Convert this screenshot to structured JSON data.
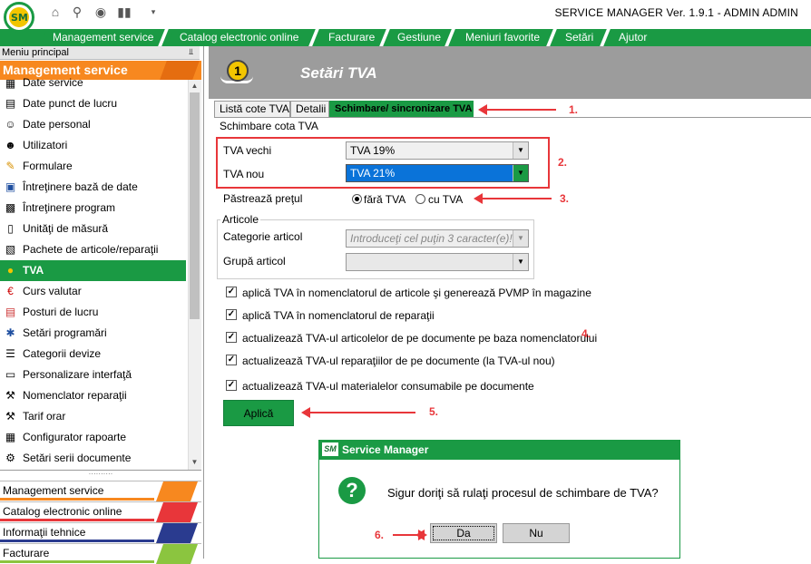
{
  "app": {
    "title": "SERVICE MANAGER Ver. 1.9.1 - ADMIN ADMIN",
    "logo_text": "SM"
  },
  "quick_toolbar": [
    "home-icon",
    "search-icon",
    "binoculars-icon",
    "barcode-icon",
    "dropdown-icon"
  ],
  "menu": [
    {
      "label": "Management service"
    },
    {
      "label": "Catalog electronic online"
    },
    {
      "label": "Facturare"
    },
    {
      "label": "Gestiune"
    },
    {
      "label": "Meniuri favorite"
    },
    {
      "label": "Setări"
    },
    {
      "label": "Ajutor"
    }
  ],
  "left_panel": {
    "header": "Meniu principal",
    "pin": "⫫",
    "category": "Management service",
    "items": [
      {
        "label": "Date service",
        "icon": "building-icon"
      },
      {
        "label": "Date punct de lucru",
        "icon": "document-icon"
      },
      {
        "label": "Date personal",
        "icon": "person-icon"
      },
      {
        "label": "Utilizatori",
        "icon": "users-icon"
      },
      {
        "label": "Formulare",
        "icon": "pencil-icon"
      },
      {
        "label": "Întreţinere bază de date",
        "icon": "floppy-icon"
      },
      {
        "label": "Întreţinere program",
        "icon": "program-icon"
      },
      {
        "label": "Unităţi de măsură",
        "icon": "ruler-icon"
      },
      {
        "label": "Pachete de articole/reparaţii",
        "icon": "package-icon"
      },
      {
        "label": "TVA",
        "icon": "tva-icon",
        "selected": true
      },
      {
        "label": "Curs valutar",
        "icon": "euro-icon"
      },
      {
        "label": "Posturi de lucru",
        "icon": "workstation-icon"
      },
      {
        "label": "Setări programări",
        "icon": "wrench-icon"
      },
      {
        "label": "Categorii devize",
        "icon": "list-icon"
      },
      {
        "label": "Personalizare interfaţă",
        "icon": "monitor-icon"
      },
      {
        "label": "Nomenclator reparaţii",
        "icon": "tools-icon"
      },
      {
        "label": "Tarif orar",
        "icon": "hammer-icon"
      },
      {
        "label": "Configurator rapoarte",
        "icon": "report-icon"
      },
      {
        "label": "Setări serii documente",
        "icon": "gear-icon"
      }
    ],
    "bottom_categories": [
      {
        "label": "Management service",
        "color": "#f7881f"
      },
      {
        "label": "Catalog electronic online",
        "color": "#e8363a"
      },
      {
        "label": "Informaţii tehnice",
        "color": "#2a3b8f"
      },
      {
        "label": "Facturare",
        "color": "#8bc53f"
      }
    ]
  },
  "main": {
    "title": "Setări TVA",
    "tabs": [
      {
        "label": "Listă cote TVA"
      },
      {
        "label": "Detalii"
      },
      {
        "label": "Schimbare/ sincronizare TVA",
        "active": true
      }
    ],
    "section_title": "Schimbare cota TVA",
    "tva_old_label": "TVA vechi",
    "tva_old_value": "TVA 19%",
    "tva_new_label": "TVA nou",
    "tva_new_value": "TVA 21%",
    "keep_price_label": "Păstrează preţul",
    "radio_without": "fără TVA",
    "radio_with": "cu TVA",
    "articles_group": "Articole",
    "category_label": "Categorie articol",
    "category_placeholder": "Introduceţi cel puţin 3 caracter(e)!",
    "group_label": "Grupă articol",
    "group_value": "",
    "checkboxes": [
      "aplică TVA în nomenclatorul de articole şi generează PVMP în magazine",
      "aplică TVA în nomenclatorul de reparaţii",
      "actualizează TVA-ul articolelor de pe documente pe baza nomenclatorului",
      "actualizează TVA-ul reparaţiilor de pe documente (la TVA-ul nou)",
      "actualizează TVA-ul materialelor consumabile pe documente"
    ],
    "apply_label": "Aplică"
  },
  "annotations": [
    "1.",
    "2.",
    "3.",
    "4.",
    "5.",
    "6."
  ],
  "dialog": {
    "title": "Service Manager",
    "logo_text": "SM",
    "message": "Sigur doriţi să rulaţi procesul de schimbare de TVA?",
    "yes": "Da",
    "no": "Nu"
  },
  "colors": {
    "brand_green": "#1a9a44",
    "accent_orange": "#f7881f",
    "annotation_red": "#e8363a",
    "selection_blue": "#0a73d9"
  }
}
